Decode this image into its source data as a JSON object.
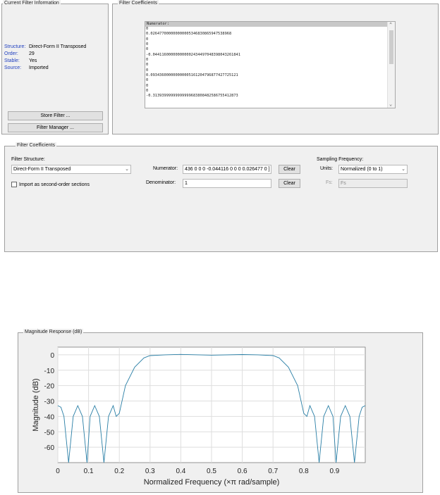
{
  "current_filter": {
    "title": "Current Filter Information",
    "rows": [
      {
        "key": "Structure:",
        "value": "Direct-Form II Transposed"
      },
      {
        "key": "Order:",
        "value": "29"
      },
      {
        "key": "Stable:",
        "value": "Yes"
      },
      {
        "key": "Source:",
        "value": "Imported"
      }
    ],
    "store_button": "Store Filter ...",
    "manager_button": "Filter Manager ..."
  },
  "coeff_view": {
    "title": "Filter Coefficients",
    "header": "Numerator:",
    "lines": [
      " 0",
      " 0.026477000000000005346830865947538968",
      " 0",
      " 0",
      " 0",
      "-0.044116000000000002434497048398043261841",
      " 0",
      " 0",
      " 0",
      " 0.093436000000000005161204796877427725121",
      " 0",
      " 0",
      " 0",
      "-0.31393999999999999683808482586755412873"
    ]
  },
  "coeff_panel": {
    "title": "Filter Coefficients",
    "structure_label": "Filter Structure:",
    "structure_value": "Direct-Form II Transposed",
    "sos_label": "Import as second-order sections",
    "numerator_label": "Numerator:",
    "numerator_value": "436 0 0 0 -0.044116 0 0 0 0.026477 0 ]",
    "denominator_label": "Denominator:",
    "denominator_value": "1",
    "clear_label": "Clear",
    "sampling_label": "Sampling Frequency:",
    "units_label": "Units:",
    "units_value": "Normalized (0 to 1)",
    "fs_label": "Fs:",
    "fs_placeholder": "Fs"
  },
  "plot": {
    "title": "Magnitude Response (dB)"
  },
  "chart_data": {
    "type": "line",
    "xlabel": "Normalized Frequency (×π rad/sample)",
    "ylabel": "Magnitude (dB)",
    "xlim": [
      0,
      1
    ],
    "ylim": [
      -70,
      5
    ],
    "xticks": [
      0,
      0.1,
      0.2,
      0.3,
      0.4,
      0.5,
      0.6,
      0.7,
      0.8,
      0.9
    ],
    "yticks": [
      0,
      -10,
      -20,
      -30,
      -40,
      -50,
      -60
    ],
    "grid": true,
    "line_color": "#2a7fa6",
    "series": [
      {
        "x": [
          0,
          0.01,
          0.02,
          0.035,
          0.05,
          0.065,
          0.08,
          0.095,
          0.105,
          0.12,
          0.135,
          0.15,
          0.165,
          0.18,
          0.19,
          0.2,
          0.22,
          0.25,
          0.28,
          0.3,
          0.35,
          0.4,
          0.5,
          0.6,
          0.65,
          0.7,
          0.72,
          0.75,
          0.78,
          0.8,
          0.81,
          0.82,
          0.835,
          0.85,
          0.865,
          0.88,
          0.895,
          0.905,
          0.92,
          0.935,
          0.95,
          0.965,
          0.98,
          0.99,
          1.0
        ],
        "y": [
          -33,
          -34,
          -40,
          -70,
          -40,
          -33,
          -40,
          -70,
          -40,
          -33,
          -40,
          -70,
          -40,
          -33,
          -40,
          -38,
          -20,
          -8,
          -2,
          -0.5,
          0,
          0.3,
          -0.2,
          0.2,
          0,
          -0.5,
          -2,
          -8,
          -20,
          -38,
          -40,
          -33,
          -40,
          -70,
          -40,
          -33,
          -40,
          -70,
          -40,
          -33,
          -40,
          -70,
          -40,
          -34,
          -33
        ]
      }
    ]
  }
}
